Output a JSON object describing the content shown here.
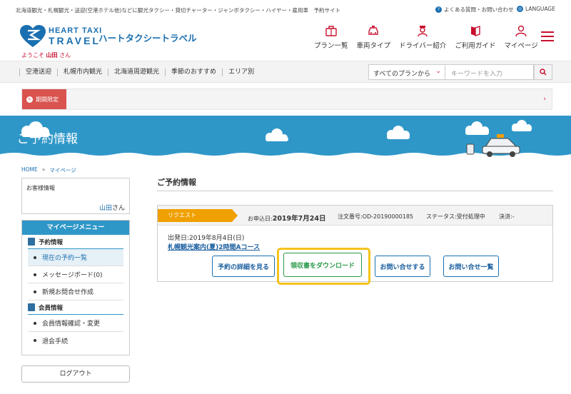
{
  "topbar": {
    "tagline": "北海道観光・札幌観光・送迎(空港ホテル他)などに観光タクシー・貸切チャーター・ジャンボタクシー・ハイヤー・雇用車　予約サイト",
    "faq": "よくある質問・お問い合わせ",
    "language": "LANGUAGE"
  },
  "header": {
    "brand_en_line1": "HEART TAXI",
    "brand_en_line2": "TRAVEL",
    "brand_jp": "ハートタクシートラベル",
    "welcome_prefix": "ようこそ",
    "welcome_name": "山田",
    "welcome_suffix": "さん",
    "nav": [
      {
        "label": "プラン一覧",
        "icon": "luggage-icon"
      },
      {
        "label": "車両タイプ",
        "icon": "car-icon"
      },
      {
        "label": "ドライバー紹介",
        "icon": "driver-icon"
      },
      {
        "label": "ご利用ガイド",
        "icon": "book-icon"
      },
      {
        "label": "マイページ",
        "icon": "user-icon"
      }
    ]
  },
  "catbar": {
    "categories": [
      "空港送迎",
      "札幌市内観光",
      "北海道周遊観光",
      "季節のおすすめ",
      "エリア別"
    ],
    "plan_select": "すべてのプランから",
    "keyword_placeholder": "キーワードを入力"
  },
  "notice": {
    "tag": "期間限定"
  },
  "banner": {
    "title": "ご予約情報"
  },
  "breadcrumb": {
    "home": "HOME",
    "sep": "»",
    "current": "マイページ"
  },
  "sidebar": {
    "customer_label": "お客様情報",
    "customer_name": "山田",
    "customer_suffix": "さん",
    "menu_title": "マイページメニュー",
    "section1": "予約情報",
    "items1": [
      "現在の予約一覧",
      "メッセージボード(0)",
      "新規お問合せ作成"
    ],
    "section2": "会員情報",
    "items2": [
      "会員情報確認・変更",
      "退会手続"
    ],
    "logout": "ログアウト"
  },
  "main": {
    "title": "ご予約情報",
    "status_tag": "リクエスト",
    "apply_label": "お申込日:",
    "apply_date": "2019年7月24日",
    "order_no": "注文番号:OD-20190000185",
    "status": "ステータス:受付処理中",
    "payment": "決済:-",
    "departure": "出発日:2019年8月4日(日)",
    "course": "札幌観光案内(夏)2時間Aコース",
    "buttons": {
      "details": "予約の詳細を見る",
      "receipt": "領収書をダウンロード",
      "inquire": "お問い合せする",
      "inquiry_list": "お問い合せ一覧"
    }
  },
  "colors": {
    "brand": "#1a6fb0",
    "accent": "#c8102e",
    "banner": "#2f97c8",
    "request": "#f0a000",
    "highlight": "#f5c31c"
  }
}
